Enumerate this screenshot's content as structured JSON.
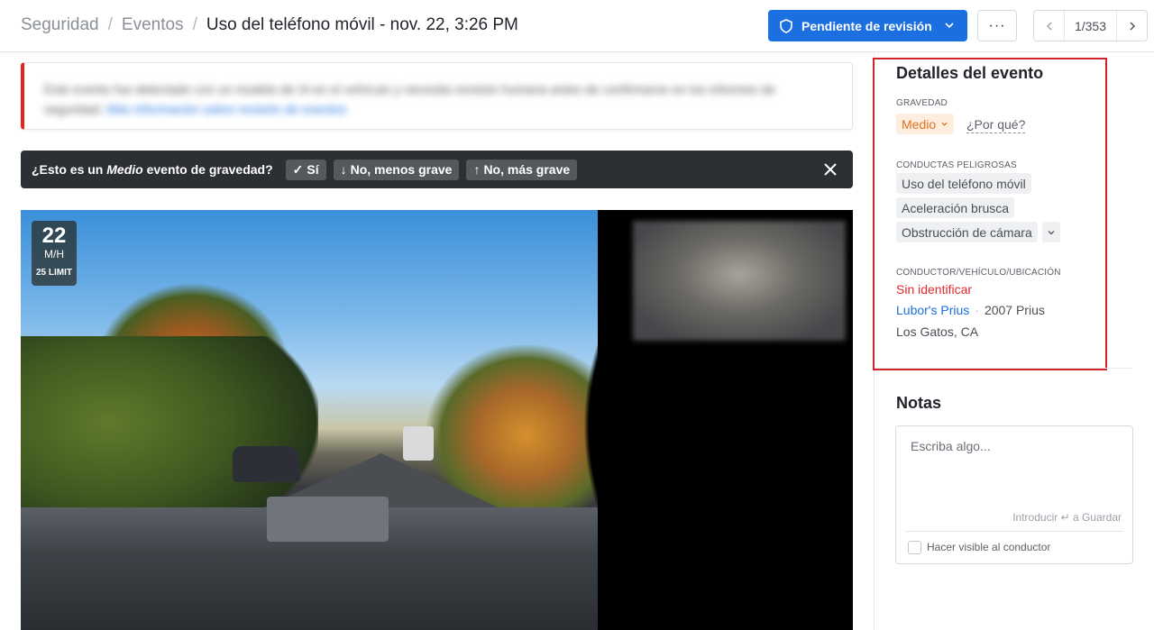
{
  "breadcrumb": {
    "items": [
      "Seguridad",
      "Eventos"
    ],
    "separator": "/",
    "current": "Uso del teléfono móvil - nov. 22, 3:26 PM"
  },
  "toolbar": {
    "status_label": "Pendiente de revisión",
    "status_icon": "shield-icon",
    "more_label": "···",
    "pager_text": "1/353",
    "accent_color": "#1b6fe0"
  },
  "banner": {
    "text": "Este evento fue detectado con un modelo de IA en el vehículo y necesita revisión humana antes de confirmarse en los informes de seguridad.",
    "link_text": "Más información sobre revisión de eventos"
  },
  "prompt": {
    "prefix": "¿Esto es un",
    "severity": "Medio",
    "suffix": "evento de gravedad?",
    "yes": "Sí",
    "less": "No, menos grave",
    "more": "No, más grave"
  },
  "video": {
    "speed": "22",
    "speed_unit": "M/H",
    "speed_limit": "25 LIMIT"
  },
  "details": {
    "title": "Detalles del evento",
    "severity_label": "GRAVEDAD",
    "severity_value": "Medio",
    "severity_color": "#e0701a",
    "why_link": "¿Por qué?",
    "behaviors_label": "CONDUCTAS PELIGROSAS",
    "behaviors": [
      "Uso del teléfono móvil",
      "Aceleración brusca",
      "Obstrucción de cámara"
    ],
    "dvl_label": "CONDUCTOR/VEHÍCULO/UBICACIÓN",
    "driver": "Sin identificar",
    "vehicle_name": "Lubor's Prius",
    "vehicle_model": "2007 Prius",
    "location": "Los Gatos, CA"
  },
  "notes": {
    "title": "Notas",
    "placeholder": "Escriba algo...",
    "hint": "Introducir ↵ a Guardar",
    "visible_label": "Hacer visible al conductor"
  }
}
